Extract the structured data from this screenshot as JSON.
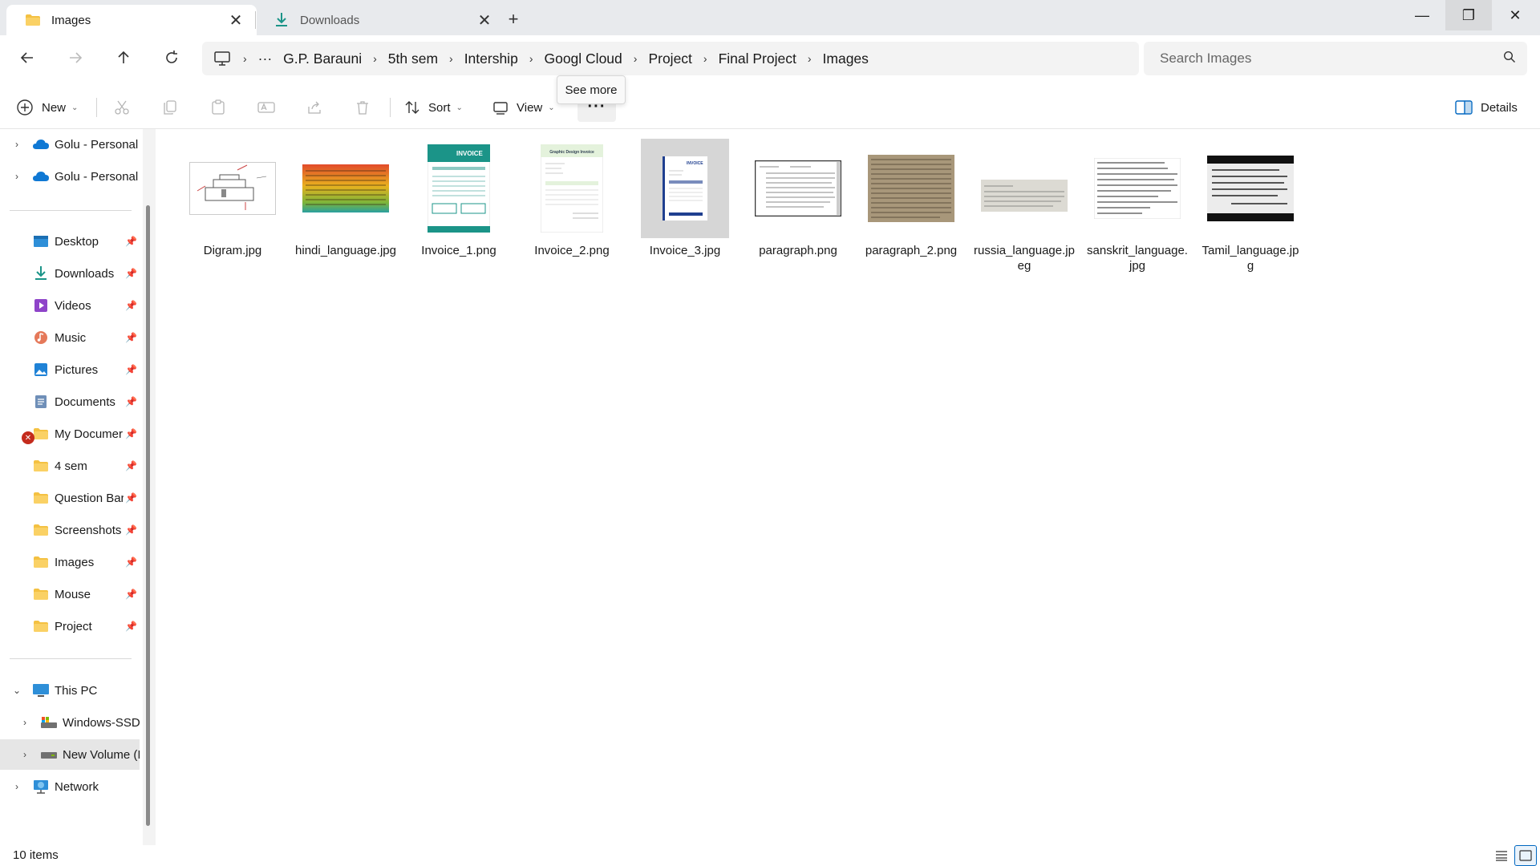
{
  "tabs": [
    {
      "label": "Images",
      "icon": "folder-icon",
      "active": true
    },
    {
      "label": "Downloads",
      "icon": "download-icon",
      "active": false
    }
  ],
  "window_controls": {
    "minimize": "—",
    "restore": "❐",
    "close": "✕"
  },
  "breadcrumb": {
    "overflow": "···",
    "items": [
      "G.P. Barauni",
      "5th sem",
      "Intership",
      "Googl Cloud",
      "Project",
      "Final Project",
      "Images"
    ]
  },
  "search": {
    "placeholder": "Search Images"
  },
  "toolbar": {
    "new_label": "New",
    "sort_label": "Sort",
    "view_label": "View",
    "more_label": "···",
    "details_label": "Details",
    "tooltip": "See more"
  },
  "sidebar": {
    "cloud": [
      {
        "label": "Golu - Personal",
        "icon": "onedrive-icon"
      },
      {
        "label": "Golu - Personal",
        "icon": "onedrive-icon"
      }
    ],
    "quick_access": [
      {
        "label": "Desktop",
        "icon": "desktop-icon"
      },
      {
        "label": "Downloads",
        "icon": "download-icon"
      },
      {
        "label": "Videos",
        "icon": "video-icon"
      },
      {
        "label": "Music",
        "icon": "music-icon"
      },
      {
        "label": "Pictures",
        "icon": "pictures-icon"
      },
      {
        "label": "Documents",
        "icon": "documents-icon"
      },
      {
        "label": "My Documer",
        "icon": "folder-error-icon"
      },
      {
        "label": "4 sem",
        "icon": "folder-icon"
      },
      {
        "label": "Question Bar",
        "icon": "folder-icon"
      },
      {
        "label": "Screenshots",
        "icon": "folder-icon"
      },
      {
        "label": "Images",
        "icon": "folder-icon"
      },
      {
        "label": "Mouse",
        "icon": "folder-icon"
      },
      {
        "label": "Project",
        "icon": "folder-icon"
      }
    ],
    "this_pc": {
      "label": "This PC",
      "icon": "pc-icon"
    },
    "drives": [
      {
        "label": "Windows-SSD",
        "icon": "drive-icon"
      },
      {
        "label": "New Volume (I",
        "icon": "drive-icon"
      }
    ],
    "network": {
      "label": "Network",
      "icon": "network-icon"
    }
  },
  "files": [
    {
      "name": "Digram.jpg",
      "thumb": "diagram"
    },
    {
      "name": "hindi_language.jpg",
      "thumb": "hindi"
    },
    {
      "name": "Invoice_1.png",
      "thumb": "invoice1"
    },
    {
      "name": "Invoice_2.png",
      "thumb": "invoice2"
    },
    {
      "name": "Invoice_3.jpg",
      "thumb": "invoice3"
    },
    {
      "name": "paragraph.png",
      "thumb": "paragraph"
    },
    {
      "name": "paragraph_2.png",
      "thumb": "paragraph2"
    },
    {
      "name": "russia_language.jpeg",
      "thumb": "russia"
    },
    {
      "name": "sanskrit_language.jpg",
      "thumb": "sanskrit"
    },
    {
      "name": "Tamil_language.jpg",
      "thumb": "tamil"
    }
  ],
  "thumbnail_text": {
    "invoice1_heading": "INVOICE",
    "invoice3_heading": "INVOICE",
    "invoice2_heading": "Graphic Design Invoice"
  },
  "status": {
    "item_count": "10 items"
  },
  "colors": {
    "accent": "#0067c0",
    "folder": "#f4c142",
    "onedrive": "#0f78d4",
    "invoice_teal": "#1b9488"
  }
}
